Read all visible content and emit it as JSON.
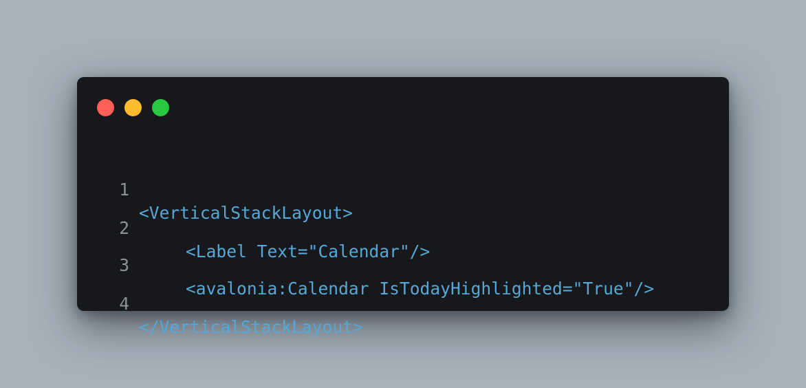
{
  "window": {
    "controls": [
      {
        "name": "close",
        "color": "#ff5f57"
      },
      {
        "name": "minimize",
        "color": "#febc2e"
      },
      {
        "name": "maximize",
        "color": "#28c840"
      }
    ]
  },
  "code": {
    "language": "xml",
    "lines": [
      {
        "number": "1",
        "text": "<VerticalStackLayout>"
      },
      {
        "number": "2",
        "text": "<Label Text=\"Calendar\"/>"
      },
      {
        "number": "3",
        "text": "<avalonia:Calendar IsTodayHighlighted=\"True\"/>"
      },
      {
        "number": "4",
        "text": "</VerticalStackLayout>"
      }
    ]
  },
  "colors": {
    "background": "#a6b1bc",
    "editor": "#17181b",
    "code_text": "#56a8d6",
    "line_number": "#8b9490"
  }
}
